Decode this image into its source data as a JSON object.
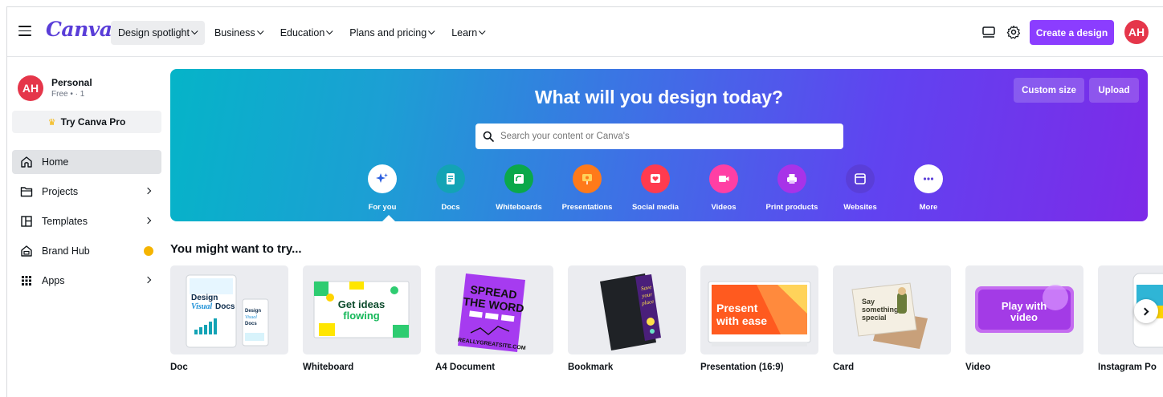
{
  "header": {
    "logo": "Canva",
    "nav": [
      {
        "label": "Design spotlight",
        "active": true
      },
      {
        "label": "Business",
        "active": false
      },
      {
        "label": "Education",
        "active": false
      },
      {
        "label": "Plans and pricing",
        "active": false
      },
      {
        "label": "Learn",
        "active": false
      }
    ],
    "create_label": "Create a design",
    "avatar_initials": "AH"
  },
  "sidebar": {
    "profile_name": "Personal",
    "profile_sub": "Free • · 1",
    "avatar_initials": "AH",
    "try_pro_label": "Try Canva Pro",
    "items": [
      {
        "label": "Home",
        "icon": "home-icon"
      },
      {
        "label": "Projects",
        "icon": "folder-icon"
      },
      {
        "label": "Templates",
        "icon": "templates-icon"
      },
      {
        "label": "Brand Hub",
        "icon": "brand-hub-icon"
      },
      {
        "label": "Apps",
        "icon": "apps-icon"
      }
    ]
  },
  "hero": {
    "title": "What will you design today?",
    "custom_size_label": "Custom size",
    "upload_label": "Upload",
    "search_placeholder": "Search your content or Canva's",
    "categories": [
      {
        "label": "For you",
        "color": "#ffffff",
        "icon": "sparkle-icon"
      },
      {
        "label": "Docs",
        "color": "#13a3b5",
        "icon": "docs-icon"
      },
      {
        "label": "Whiteboards",
        "color": "#0ba84a",
        "icon": "whiteboard-icon"
      },
      {
        "label": "Presentations",
        "color": "#ff7a1a",
        "icon": "presentation-icon"
      },
      {
        "label": "Social media",
        "color": "#ff3b4f",
        "icon": "heart-icon"
      },
      {
        "label": "Videos",
        "color": "#ff3fa4",
        "icon": "video-icon"
      },
      {
        "label": "Print products",
        "color": "#a833e8",
        "icon": "printer-icon"
      },
      {
        "label": "Websites",
        "color": "#5a3ed8",
        "icon": "website-icon"
      },
      {
        "label": "More",
        "color": "#ffffff",
        "icon": "more-icon"
      }
    ]
  },
  "try_section": {
    "title": "You might want to try...",
    "cards": [
      {
        "label": "Doc",
        "thumb_text": "Design Visual Docs"
      },
      {
        "label": "Whiteboard",
        "thumb_text": "Get ideas flowing"
      },
      {
        "label": "A4 Document",
        "thumb_text": "SPREAD THE WORD"
      },
      {
        "label": "Bookmark",
        "thumb_text": "Save your place"
      },
      {
        "label": "Presentation (16:9)",
        "thumb_text": "Present with ease"
      },
      {
        "label": "Card",
        "thumb_text": "Say something special"
      },
      {
        "label": "Video",
        "thumb_text": "Play with video"
      },
      {
        "label": "Instagram Po",
        "thumb_text": ""
      }
    ]
  },
  "colors": {
    "brand_purple": "#8b3dff",
    "avatar_red": "#e5364a",
    "hero_start": "#05b4c8",
    "hero_end": "#7d2ae8"
  }
}
